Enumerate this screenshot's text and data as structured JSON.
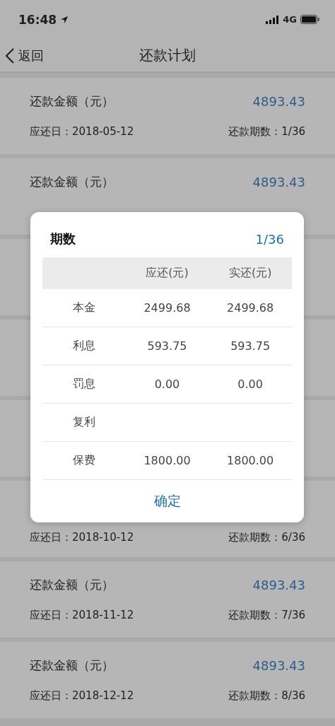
{
  "status_bar": {
    "time": "16:48",
    "network": "4G"
  },
  "nav": {
    "back": "返回",
    "title": "还款计划"
  },
  "cards": [
    {
      "kind": "full",
      "title": "还款金额（元）",
      "amount": "4893.43",
      "due": "应还日：2018-05-12",
      "period": "还款期数：1/36"
    },
    {
      "kind": "top",
      "title": "还款金额（元）",
      "amount": "4893.43"
    },
    {
      "kind": "covered"
    },
    {
      "kind": "covered"
    },
    {
      "kind": "covered"
    },
    {
      "kind": "bottom",
      "due": "应还日：2018-10-12",
      "period": "还款期数：6/36"
    },
    {
      "kind": "full",
      "title": "还款金额（元）",
      "amount": "4893.43",
      "due": "应还日：2018-11-12",
      "period": "还款期数：7/36"
    },
    {
      "kind": "full",
      "title": "还款金额（元）",
      "amount": "4893.43",
      "due": "应还日：2018-12-12",
      "period": "还款期数：8/36"
    }
  ],
  "dialog": {
    "title": "期数",
    "period": "1/36",
    "columns": [
      "应还(元)",
      "实还(元)"
    ],
    "rows": [
      {
        "label": "本金",
        "due": "2499.68",
        "paid": "2499.68"
      },
      {
        "label": "利息",
        "due": "593.75",
        "paid": "593.75"
      },
      {
        "label": "罚息",
        "due": "0.00",
        "paid": "0.00"
      },
      {
        "label": "复利"
      },
      {
        "label": "保费",
        "due": "1800.00",
        "paid": "1800.00"
      }
    ],
    "button": "确定"
  }
}
